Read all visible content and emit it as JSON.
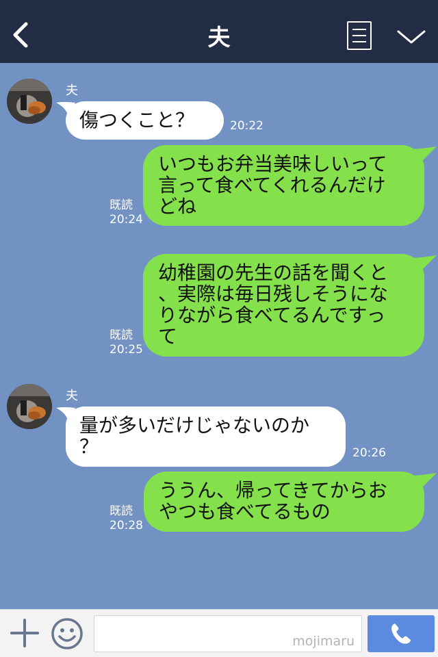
{
  "header": {
    "title": "夫",
    "back_icon": "chevron-left-icon",
    "notes_icon": "notes-icon",
    "menu_icon": "chevron-down-icon",
    "background_color": "#232c45"
  },
  "chat": {
    "background_color": "#7292c3",
    "incoming_bubble_color": "#ffffff",
    "outgoing_bubble_color": "#84e04b",
    "read_label": "既読",
    "messages": [
      {
        "direction": "incoming",
        "sender": "夫",
        "text": "傷つくこと？",
        "time": "20:22"
      },
      {
        "direction": "outgoing",
        "lines": [
          "いつもお弁当美味しいって",
          "言って食べてくれるんだけ",
          "どね"
        ],
        "read": "既読",
        "time": "20:24"
      },
      {
        "direction": "outgoing",
        "lines": [
          "幼稚園の先生の話を聞くと",
          "、実際は毎日残しそうにな",
          "りながら食べてるんですっ",
          "て"
        ],
        "read": "既読",
        "time": "20:25"
      },
      {
        "direction": "incoming",
        "sender": "夫",
        "lines": [
          "量が多いだけじゃないのか",
          "？"
        ],
        "time": "20:26"
      },
      {
        "direction": "outgoing",
        "lines": [
          "ううん、帰ってきてからお",
          "やつも食べてるもの"
        ],
        "read": "既読",
        "time": "20:28"
      }
    ]
  },
  "input_bar": {
    "plus_icon": "plus-icon",
    "emoji_icon": "smiley-icon",
    "text_value": "",
    "watermark": "mojimaru",
    "call_icon": "phone-icon",
    "call_color": "#5b8be0"
  }
}
